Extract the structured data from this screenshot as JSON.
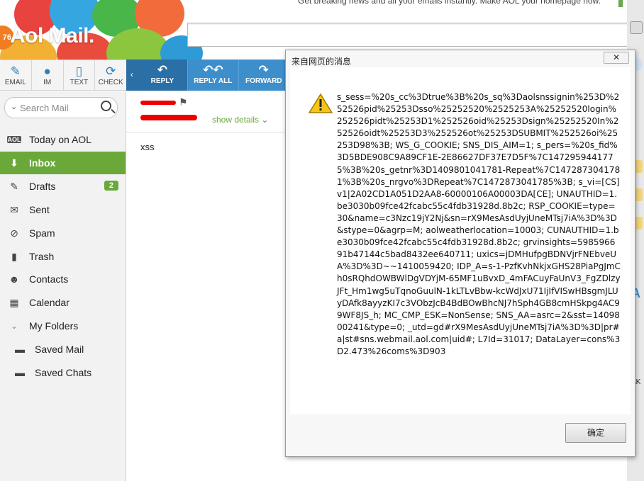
{
  "header": {
    "promo_text": "Get breaking news and all your emails instantly. Make AOL your homepage now.",
    "logo_badge": "76",
    "logo_text": "Aol Mail."
  },
  "toolbar": {
    "email": "EMAIL",
    "im": "IM",
    "text": "TEXT",
    "check": "CHECK"
  },
  "read_toolbar": {
    "reply": "REPLY",
    "reply_all": "REPLY ALL",
    "forward": "FORWARD"
  },
  "search": {
    "placeholder": "Search Mail"
  },
  "sidebar": {
    "items": [
      {
        "label": "Today on AOL",
        "icon": "aol-icon"
      },
      {
        "label": "Inbox",
        "icon": "inbox-icon"
      },
      {
        "label": "Drafts",
        "icon": "drafts-icon",
        "badge": "2"
      },
      {
        "label": "Sent",
        "icon": "sent-icon"
      },
      {
        "label": "Spam",
        "icon": "spam-icon"
      },
      {
        "label": "Trash",
        "icon": "trash-icon"
      },
      {
        "label": "Contacts",
        "icon": "contacts-icon"
      },
      {
        "label": "Calendar",
        "icon": "calendar-icon"
      },
      {
        "label": "My Folders",
        "icon": "chevron-down-icon"
      },
      {
        "label": "Saved Mail",
        "icon": "folder-icon"
      },
      {
        "label": "Saved Chats",
        "icon": "folder-icon"
      }
    ]
  },
  "message": {
    "show_details": "show details",
    "body": "xss"
  },
  "dialog": {
    "title": "来自网页的消息",
    "close": "✕",
    "message": "s_sess=%20s_cc%3Dtrue%3B%20s_sq%3Daolsnssignin%253D%252526pid%25253Dsso%25252520%2525253A%25252520login%252526pidt%25253D1%252526oid%25253Dsign%25252520In%252526oidt%25253D3%252526ot%25253DSUBMIT%252526oi%25253D98%3B; WS_G_COOKIE; SNS_DIS_AIM=1; s_pers=%20s_fid%3D5BDE908C9A89CF1E-2E86627DF37E7D5F%7C1472959441775%3B%20s_getnr%3D1409801041781-Repeat%7C1472873041781%3B%20s_nrgvo%3DRepeat%7C1472873041785%3B; s_vi=[CS]v1|2A02CD1A051D2AA8-60000106A00003DA[CE]; UNAUTHID=1.be3030b09fce42fcabc55c4fdb31928d.8b2c; RSP_COOKIE=type=30&name=c3Nzc19jY2Nj&sn=rX9MesAsdUyjUneMTsj7iA%3D%3D&stype=0&agrp=M; aolweatherlocation=10003; CUNAUTHID=1.be3030b09fce42fcabc55c4fdb31928d.8b2c; grvinsights=598596691b47144c5bad8432ee640711; uxics=jDMHufpgBDNVjrFNEbveUA%3D%3D~~1410059420; IDP_A=s-1-PzfKvhNkjxGHS28PiaPgJmCh0sRQhdOWBWlDgVDYjM-65MF1uBvxD_4mFACuyFaUnV3_FgZDlzyJFt_Hm1wg5uTqnoGuulN-1kLTLvBbw-kcWdJxU71IjIfVISwHBsgmJLUyDAfk8ayyzKI7c3VObzJcB4BdBOwBhcNJ7hSph4GB8cmHSkpg4AC99WF8JS_h; MC_CMP_ESK=NonSense; SNS_AA=asrc=2&sst=1409800241&type=0; _utd=gd#rX9MesAsdUyjUneMTsj7iA%3D%3D|pr#a|st#sns.webmail.aol.com|uid#; L7Id=31017; DataLayer=cons%3D2.473%26coms%3D903",
    "ok": "确定"
  },
  "right_strip": {
    "a": "A",
    "ak": "AK"
  },
  "colors": {
    "accent_green": "#6aa83a",
    "toolbar_blue": "#3d8fcc",
    "aol_orange": "#f07d22"
  }
}
